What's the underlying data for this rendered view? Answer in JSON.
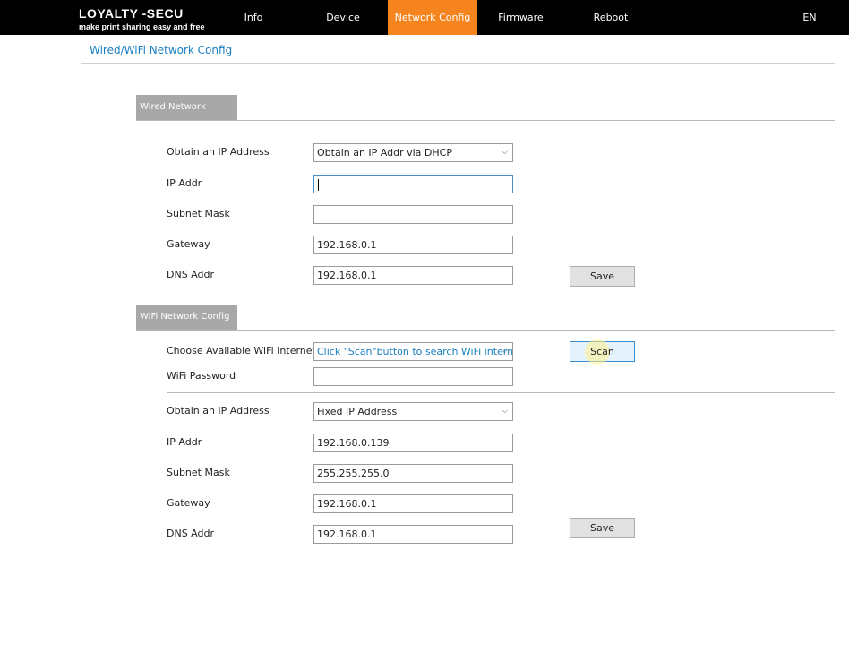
{
  "brand": {
    "title": "LOYALTY -SECU",
    "tagline": "make print sharing easy and free"
  },
  "nav": {
    "info": "Info",
    "device_parameter": "Device Parameter",
    "network_config": "Network Config",
    "firmware_upgrade": "Firmware Upgrade",
    "reboot": "Reboot",
    "language": "EN",
    "active_tab": "Network Config",
    "active_color": "#f5841f"
  },
  "page_title": "Wired/WiFi Network Config",
  "wired": {
    "section_title": "Wired Network Config",
    "obtain_ip_label": "Obtain an IP Address",
    "obtain_ip_value": "Obtain an IP Addr via DHCP",
    "ip_label": "IP Addr",
    "ip_value": "",
    "subnet_label": "Subnet Mask",
    "subnet_value": "",
    "gateway_label": "Gateway",
    "gateway_value": "192.168.0.1",
    "dns_label": "DNS Addr",
    "dns_value": "192.168.0.1",
    "save_label": "Save"
  },
  "wifi": {
    "section_title": "WiFi Network Config",
    "choose_label": "Choose Available WiFi Internet",
    "choose_value": "Click \"Scan\"button to search WiFi internet",
    "scan_label": "Scan",
    "password_label": "WiFi Password",
    "password_value": "",
    "obtain_ip_label": "Obtain an IP Address",
    "obtain_ip_value": "Fixed IP Address",
    "ip_label": "IP Addr",
    "ip_value": "192.168.0.139",
    "subnet_label": "Subnet Mask",
    "subnet_value": "255.255.255.0",
    "gateway_label": "Gateway",
    "gateway_value": "192.168.0.1",
    "dns_label": "DNS Addr",
    "dns_value": "192.168.0.1",
    "save_label": "Save"
  },
  "icons": {
    "dropdown": "chevron-down-icon"
  }
}
